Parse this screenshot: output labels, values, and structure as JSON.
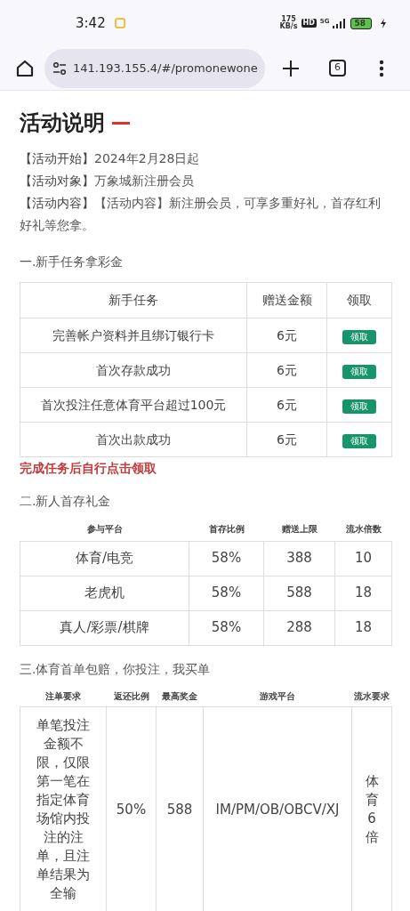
{
  "status_bar": {
    "time": "3:42",
    "speed_value": "175",
    "speed_unit": "KB/s",
    "hd": "HD",
    "network": "5G",
    "battery": "58"
  },
  "browser": {
    "url": "141.193.155.4/#/promonewone",
    "tab_count": "6"
  },
  "title": "活动说明",
  "info": [
    {
      "label": "【活动开始】",
      "value": "2024年2月28日起"
    },
    {
      "label": "【活动对象】",
      "value": "万象城新注册会员"
    },
    {
      "label": "【活动内容】",
      "value": "【活动内容】新注册会员，可享多重好礼，首存红利好礼等您拿。"
    }
  ],
  "section1": {
    "heading": "一.新手任务拿彩金",
    "columns": [
      "新手任务",
      "赠送金额",
      "领取"
    ],
    "rows": [
      {
        "task": "完善帐户资料并且绑订银行卡",
        "amount": "6元",
        "button": "领取"
      },
      {
        "task": "首次存款成功",
        "amount": "6元",
        "button": "领取"
      },
      {
        "task": "首次投注任意体育平台超过100元",
        "amount": "6元",
        "button": "领取"
      },
      {
        "task": "首次出款成功",
        "amount": "6元",
        "button": "领取"
      }
    ],
    "note": "完成任务后自行点击领取"
  },
  "section2": {
    "heading": "二.新人首存礼金",
    "columns": [
      "参与平台",
      "首存比例",
      "赠送上限",
      "流水倍数"
    ],
    "rows": [
      [
        "体育/电竞",
        "58%",
        "388",
        "10"
      ],
      [
        "老虎机",
        "58%",
        "588",
        "18"
      ],
      [
        "真人/彩票/棋牌",
        "58%",
        "288",
        "18"
      ]
    ]
  },
  "section3": {
    "heading": "三.体育首单包赔，你投注，我买单",
    "columns": [
      "注单要求",
      "返还比例",
      "最高奖金",
      "游戏平台",
      "流水要求"
    ],
    "rows": [
      [
        "单笔投注金额不限，仅限第一笔在指定体育场馆内投注的注单，且注单结果为全输",
        "50%",
        "588",
        "IM/PM/OB/OBCV/XJ",
        "体育6倍"
      ]
    ]
  }
}
